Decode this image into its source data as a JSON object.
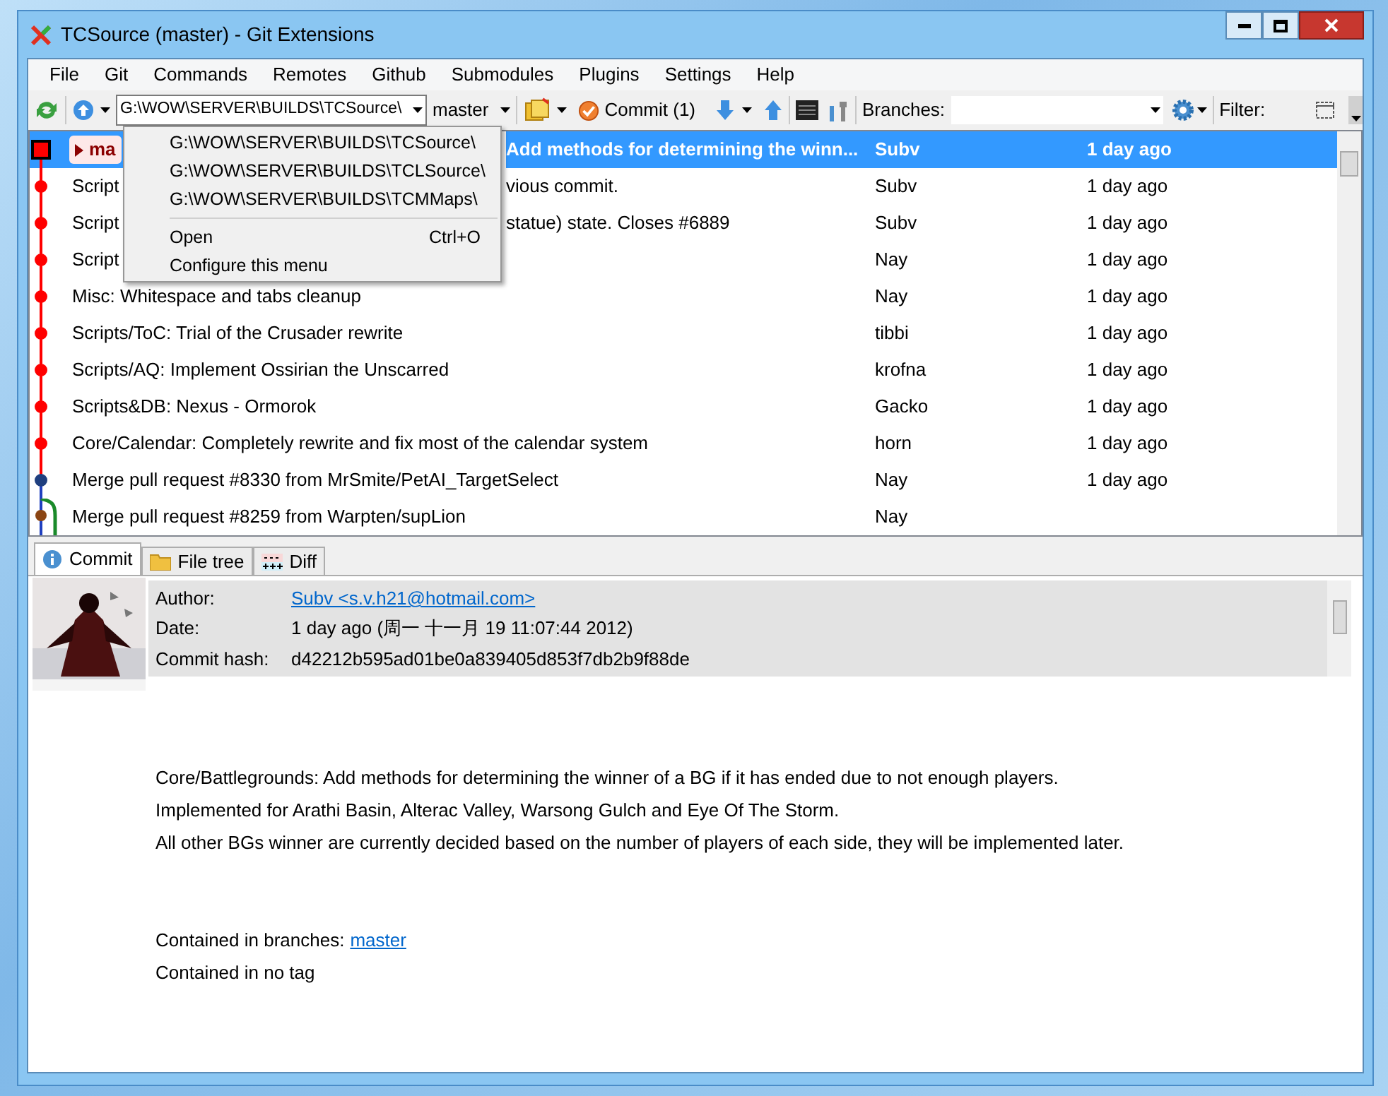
{
  "window": {
    "title": "TCSource (master) - Git Extensions"
  },
  "menu": [
    "File",
    "Git",
    "Commands",
    "Remotes",
    "Github",
    "Submodules",
    "Plugins",
    "Settings",
    "Help"
  ],
  "toolbar": {
    "path": "G:\\WOW\\SERVER\\BUILDS\\TCSource\\",
    "branch": "master",
    "commit_button": "Commit (1)",
    "branches_label": "Branches:",
    "filter_label": "Filter:"
  },
  "repo_menu": {
    "items": [
      {
        "kind": "path",
        "label": "G:\\WOW\\SERVER\\BUILDS\\TCSource\\"
      },
      {
        "kind": "path",
        "label": "G:\\WOW\\SERVER\\BUILDS\\TCLSource\\"
      },
      {
        "kind": "path",
        "label": "G:\\WOW\\SERVER\\BUILDS\\TCMMaps\\"
      },
      {
        "kind": "separator"
      },
      {
        "kind": "command",
        "label": "Open",
        "shortcut": "Ctrl+O"
      },
      {
        "kind": "command",
        "label": "Configure this menu"
      }
    ]
  },
  "commits": [
    {
      "kind": "head",
      "selected": true,
      "color": "#ff0000",
      "branch_tag": "ma",
      "message_end": "Add methods for determining the winn...",
      "author": "Subv",
      "date": "1 day ago"
    },
    {
      "kind": "covered",
      "selected": false,
      "color": "#ff0000",
      "message": "Script",
      "message_end": "vious commit.",
      "author": "Subv",
      "date": "1 day ago"
    },
    {
      "kind": "covered",
      "selected": false,
      "color": "#ff0000",
      "message": "Script",
      "message_end": "statue) state. Closes #6889",
      "author": "Subv",
      "date": "1 day ago"
    },
    {
      "kind": "covered",
      "selected": false,
      "color": "#ff0000",
      "message": "Script",
      "author": "Nay",
      "date": "1 day ago"
    },
    {
      "kind": "commit",
      "selected": false,
      "color": "#ff0000",
      "message": "Misc: Whitespace and tabs cleanup",
      "author": "Nay",
      "date": "1 day ago"
    },
    {
      "kind": "commit",
      "selected": false,
      "color": "#ff0000",
      "message": "Scripts/ToC: Trial of the Crusader rewrite",
      "author": "tibbi",
      "date": "1 day ago"
    },
    {
      "kind": "commit",
      "selected": false,
      "color": "#ff0000",
      "message": "Scripts/AQ: Implement Ossirian the Unscarred",
      "author": "krofna",
      "date": "1 day ago"
    },
    {
      "kind": "commit",
      "selected": false,
      "color": "#ff0000",
      "message": "Scripts&DB: Nexus - Ormorok",
      "author": "Gacko",
      "date": "1 day ago"
    },
    {
      "kind": "commit",
      "selected": false,
      "color": "#ff0000",
      "message": "Core/Calendar: Completely rewrite and fix most of the calendar system",
      "author": "horn",
      "date": "1 day ago"
    },
    {
      "kind": "commit",
      "selected": false,
      "color": "#1f3f7f",
      "message": "Merge pull request #8330 from MrSmite/PetAI_TargetSelect",
      "author": "Nay",
      "date": "1 day ago"
    },
    {
      "kind": "merge",
      "selected": false,
      "color": "#8b4513",
      "message": "Merge pull request #8259 from Warpten/supLion",
      "author": "Nay"
    }
  ],
  "tabs": [
    {
      "label": "Commit",
      "selected": true
    },
    {
      "label": "File tree",
      "selected": false
    },
    {
      "label": "Diff",
      "selected": false
    }
  ],
  "details": {
    "fields": [
      {
        "label": "Author:",
        "value": "Subv <s.v.h21@hotmail.com>",
        "kind": "link"
      },
      {
        "label": "Date:",
        "value": "1 day ago (周一 十一月 19 11:07:44 2012)",
        "kind": "text"
      },
      {
        "label": "Commit hash:",
        "value": "d42212b595ad01be0a839405d853f7db2b9f88de",
        "kind": "text"
      }
    ],
    "message": [
      "Core/Battlegrounds: Add methods for determining the winner of a BG if it has ended due to not enough players.",
      "Implemented for Arathi Basin, Alterac Valley, Warsong Gulch and Eye Of The Storm.",
      "All other BGs winner are currently decided based on the number of players of each side, they will be implemented later."
    ],
    "branches_label": "Contained in branches:",
    "branch_link": "master",
    "tags_text": "Contained in no tag"
  }
}
